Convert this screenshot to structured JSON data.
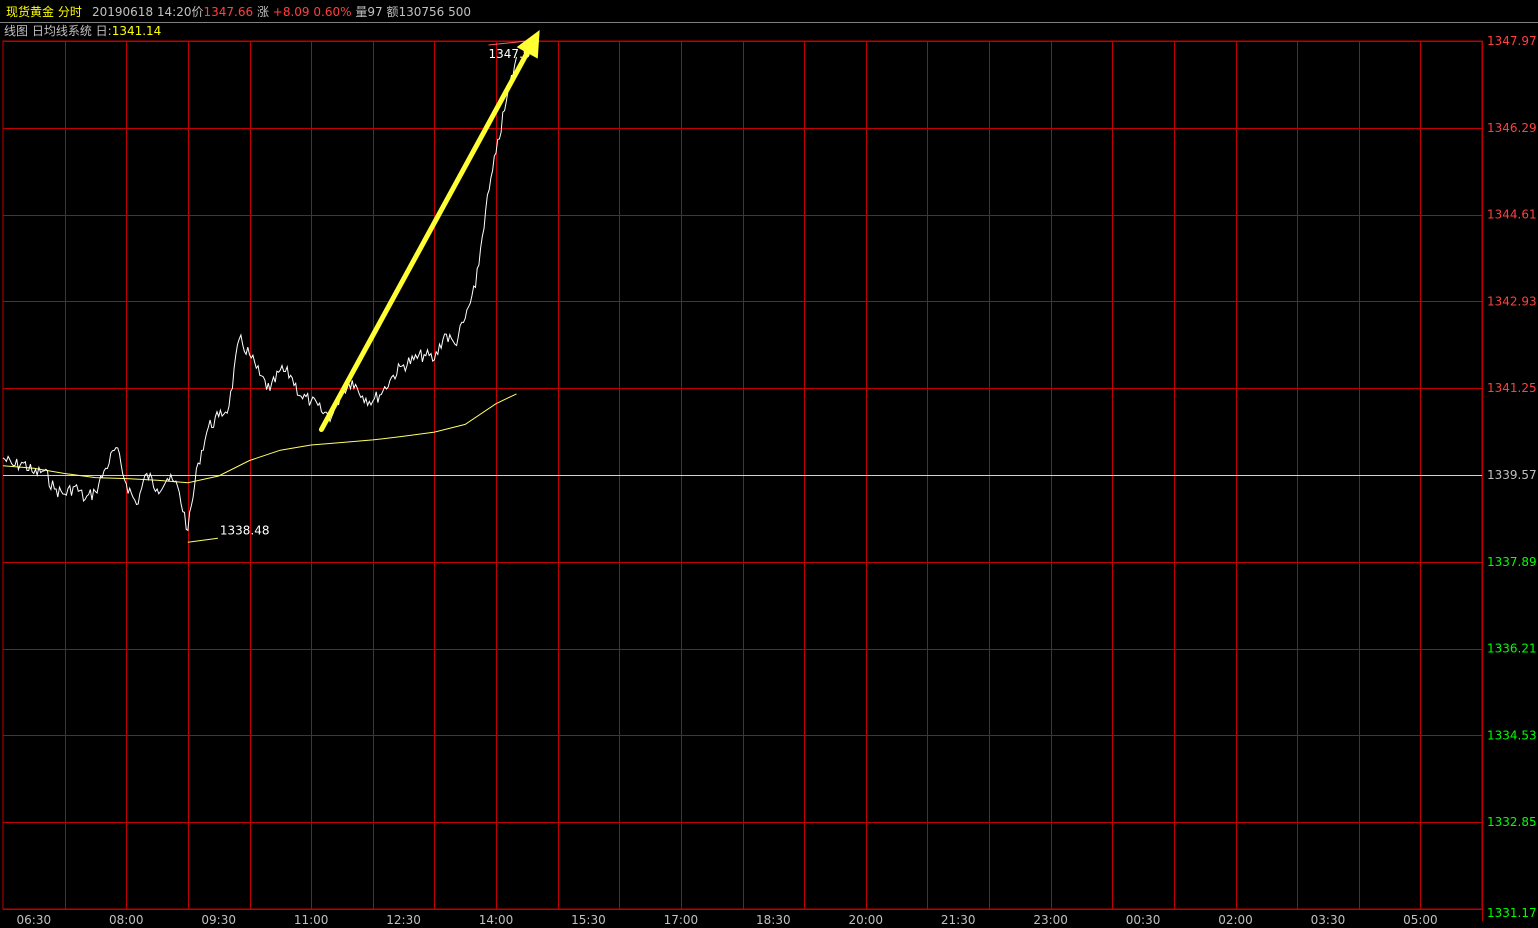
{
  "header": {
    "instrument": "现货黄金",
    "view": "分时",
    "date_time": "20190618 14:20",
    "price_label": "价",
    "price": "1347.66",
    "change_label": "涨",
    "change": "+8.09",
    "change_pct": "0.60%",
    "volume_label": "量",
    "volume": "97",
    "amount_label": "额",
    "amount": "130756",
    "extra": "500"
  },
  "subheader": {
    "text": "线图 日均线系统 日:",
    "avg_value": "1341.14"
  },
  "colors": {
    "grid": "#c00000",
    "price_line": "#ffffff",
    "avg_line": "#ffff66",
    "up_text": "#ff4040",
    "down_text": "#00ff00",
    "flat_text": "#c0c0c0",
    "arrow": "#ffff33",
    "header_text": "#ffff00"
  },
  "annotations": {
    "low_label": "1338.48",
    "high_label": "1347.9"
  },
  "chart_data": {
    "type": "line",
    "prev_close": 1339.57,
    "y_ticks": [
      "1347.97",
      "1346.29",
      "1344.61",
      "1342.93",
      "1341.25",
      "1339.57",
      "1337.89",
      "1336.21",
      "1334.53",
      "1332.85",
      "1331.17"
    ],
    "ylim": [
      1331.17,
      1347.97
    ],
    "x_ticks": [
      "06:30",
      "08:00",
      "09:30",
      "11:00",
      "12:30",
      "14:00",
      "15:30",
      "17:00",
      "18:30",
      "20:00",
      "21:30",
      "23:00",
      "00:30",
      "02:00",
      "03:30",
      "05:00"
    ],
    "x_start": "06:00",
    "x_end": "05:59",
    "series": [
      {
        "role": "price",
        "points": [
          [
            "06:00",
            1339.9
          ],
          [
            "06:10",
            1339.75
          ],
          [
            "06:20",
            1339.8
          ],
          [
            "06:30",
            1339.6
          ],
          [
            "06:40",
            1339.65
          ],
          [
            "06:50",
            1339.3
          ],
          [
            "07:00",
            1339.2
          ],
          [
            "07:10",
            1339.35
          ],
          [
            "07:20",
            1339.1
          ],
          [
            "07:30",
            1339.25
          ],
          [
            "07:40",
            1339.7
          ],
          [
            "07:50",
            1340.1
          ],
          [
            "08:00",
            1339.4
          ],
          [
            "08:10",
            1339.0
          ],
          [
            "08:20",
            1339.6
          ],
          [
            "08:30",
            1339.3
          ],
          [
            "08:40",
            1339.5
          ],
          [
            "08:50",
            1339.35
          ],
          [
            "09:00",
            1338.5
          ],
          [
            "09:10",
            1339.8
          ],
          [
            "09:20",
            1340.5
          ],
          [
            "09:30",
            1340.7
          ],
          [
            "09:40",
            1340.9
          ],
          [
            "09:50",
            1342.2
          ],
          [
            "10:00",
            1341.9
          ],
          [
            "10:10",
            1341.5
          ],
          [
            "10:20",
            1341.2
          ],
          [
            "10:30",
            1341.6
          ],
          [
            "10:40",
            1341.5
          ],
          [
            "10:50",
            1341.1
          ],
          [
            "11:00",
            1341.0
          ],
          [
            "11:10",
            1340.8
          ],
          [
            "11:20",
            1340.7
          ],
          [
            "11:30",
            1341.2
          ],
          [
            "11:40",
            1341.4
          ],
          [
            "11:50",
            1341.1
          ],
          [
            "12:00",
            1341.0
          ],
          [
            "12:10",
            1341.2
          ],
          [
            "12:20",
            1341.5
          ],
          [
            "12:30",
            1341.7
          ],
          [
            "12:40",
            1341.8
          ],
          [
            "12:50",
            1341.9
          ],
          [
            "13:00",
            1341.8
          ],
          [
            "13:10",
            1342.3
          ],
          [
            "13:20",
            1342.1
          ],
          [
            "13:30",
            1342.6
          ],
          [
            "13:40",
            1343.2
          ],
          [
            "13:50",
            1344.7
          ],
          [
            "14:00",
            1345.8
          ],
          [
            "14:10",
            1346.8
          ],
          [
            "14:20",
            1347.66
          ]
        ]
      },
      {
        "role": "average",
        "points": [
          [
            "06:00",
            1339.75
          ],
          [
            "06:30",
            1339.7
          ],
          [
            "07:00",
            1339.6
          ],
          [
            "07:30",
            1339.52
          ],
          [
            "08:00",
            1339.5
          ],
          [
            "08:30",
            1339.47
          ],
          [
            "09:00",
            1339.42
          ],
          [
            "09:30",
            1339.55
          ],
          [
            "10:00",
            1339.85
          ],
          [
            "10:30",
            1340.05
          ],
          [
            "11:00",
            1340.15
          ],
          [
            "11:30",
            1340.2
          ],
          [
            "12:00",
            1340.25
          ],
          [
            "12:30",
            1340.32
          ],
          [
            "13:00",
            1340.4
          ],
          [
            "13:30",
            1340.55
          ],
          [
            "14:00",
            1340.95
          ],
          [
            "14:20",
            1341.14
          ]
        ]
      }
    ]
  }
}
